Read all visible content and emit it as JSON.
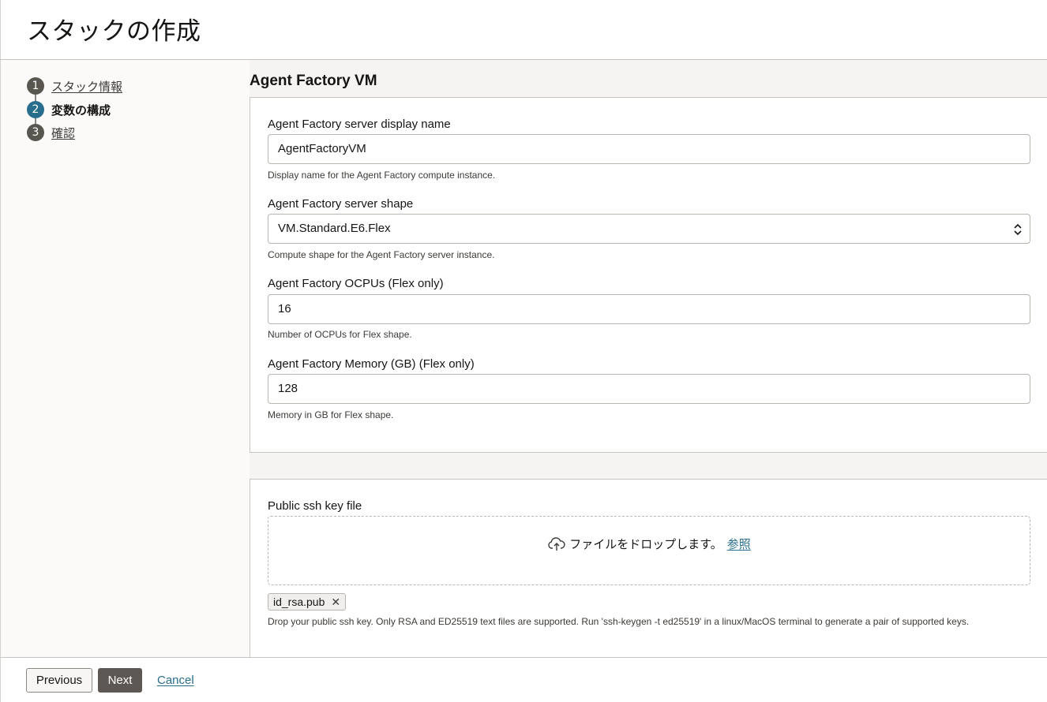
{
  "header": {
    "title": "スタックの作成"
  },
  "stepper": {
    "steps": [
      {
        "number": "1",
        "label": "スタック情報"
      },
      {
        "number": "2",
        "label": "変数の構成"
      },
      {
        "number": "3",
        "label": "確認"
      }
    ],
    "active_step": 2
  },
  "section": {
    "title": "Agent Factory VM",
    "fields": [
      {
        "label": "Agent Factory server display name",
        "value": "AgentFactoryVM",
        "help": "Display name for the Agent Factory compute instance."
      },
      {
        "label": "Agent Factory server shape",
        "value": "VM.Standard.E6.Flex",
        "help": "Compute shape for the Agent Factory server instance."
      },
      {
        "label": "Agent Factory OCPUs (Flex only)",
        "value": "16",
        "help": "Number of OCPUs for Flex shape."
      },
      {
        "label": "Agent Factory Memory (GB) (Flex only)",
        "value": "128",
        "help": "Memory in GB for Flex shape."
      }
    ]
  },
  "ssh": {
    "label": "Public ssh key file",
    "dropzone_text": "ファイルをドロップします。",
    "browse_label": "参照",
    "file_chip": "id_rsa.pub",
    "help": "Drop your public ssh key. Only RSA and ED25519 text files are supported. Run 'ssh-keygen -t ed25519' in a linux/MacOS terminal to generate a pair of supported keys."
  },
  "footer": {
    "previous_label": "Previous",
    "next_label": "Next",
    "cancel_label": "Cancel"
  },
  "colors": {
    "accent": "#286e8c",
    "primary_button": "#5d5853"
  },
  "icons": [
    "upload-cloud-icon",
    "select-chevrons-icon",
    "remove-x-icon"
  ]
}
